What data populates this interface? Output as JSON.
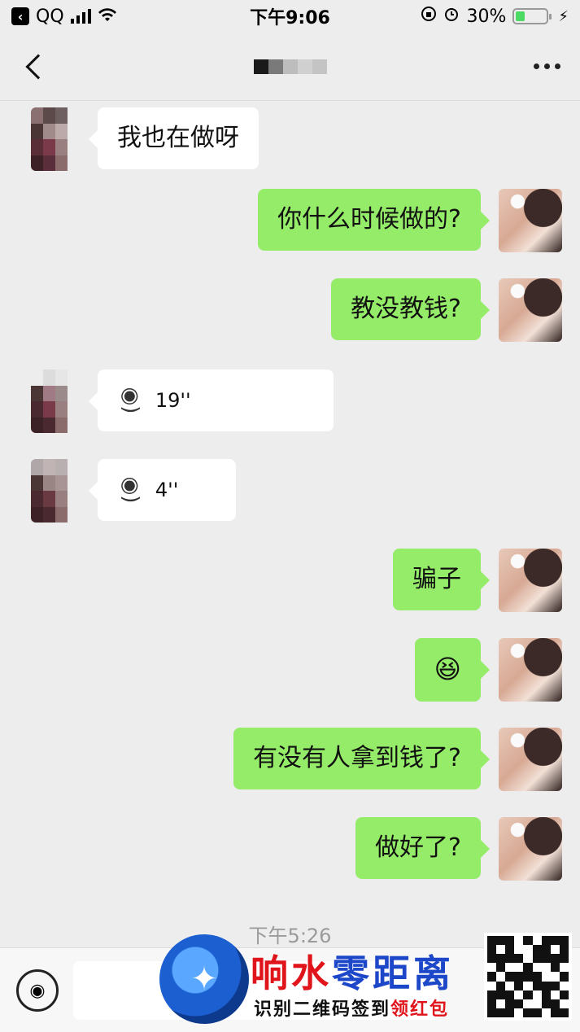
{
  "status_bar": {
    "back_app": "QQ",
    "time": "下午9:06",
    "battery_percent": "30%",
    "battery_level": 0.3,
    "icons": [
      "signal-icon",
      "wifi-icon",
      "orientation-lock-icon",
      "alarm-icon",
      "charging-icon"
    ]
  },
  "nav": {
    "back_icon": "chevron-left-icon",
    "title_redacted": true,
    "more_icon": "more-dots-icon"
  },
  "messages": [
    {
      "side": "left",
      "type": "text",
      "text": "我也在做呀"
    },
    {
      "side": "right",
      "type": "text",
      "text": "你什么时候做的?"
    },
    {
      "side": "right",
      "type": "text",
      "text": "教没教钱?"
    },
    {
      "side": "left",
      "type": "voice",
      "duration": "19''"
    },
    {
      "side": "left",
      "type": "voice",
      "duration": "4''"
    },
    {
      "side": "right",
      "type": "text",
      "text": "骗子"
    },
    {
      "side": "right",
      "type": "emoji",
      "text": "😆"
    },
    {
      "side": "right",
      "type": "text",
      "text": "有没有人拿到钱了?"
    },
    {
      "side": "right",
      "type": "text",
      "text": "做好了?"
    }
  ],
  "timestamp": "下午5:26",
  "input_bar": {
    "voice_icon": "voice-input-icon"
  },
  "watermark": {
    "title_blue_1": "响水",
    "title_blue_2": "零距离",
    "subtitle_black": "识别二维码签到",
    "subtitle_red": "领红包",
    "colors": {
      "blue": "#1c47c9",
      "red": "#e0141b"
    }
  },
  "colors": {
    "outgoing_bubble": "#95ec69",
    "incoming_bubble": "#ffffff",
    "background": "#ededed"
  }
}
